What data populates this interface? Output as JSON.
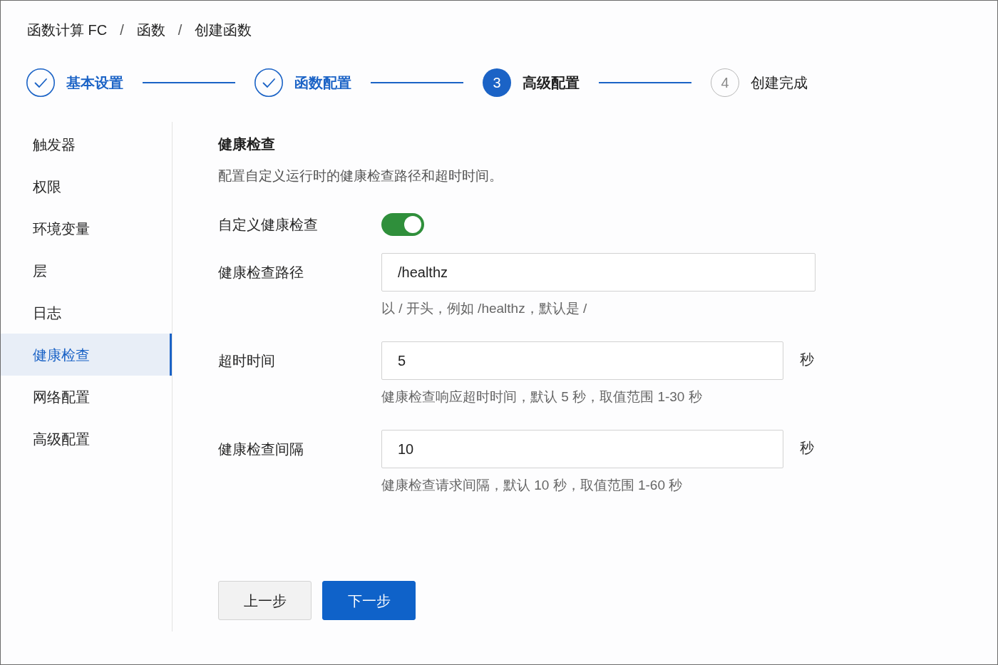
{
  "breadcrumb": [
    {
      "label": "函数计算 FC"
    },
    {
      "separator": "/",
      "label": "函数"
    },
    {
      "separator": "/",
      "label": "创建函数"
    }
  ],
  "steps": [
    {
      "kind": "done",
      "label": "基本设置"
    },
    {
      "kind": "done",
      "label": "函数配置"
    },
    {
      "kind": "current",
      "number": "3",
      "label": "高级配置"
    },
    {
      "kind": "waiting",
      "number": "4",
      "label": "创建完成"
    }
  ],
  "sidebar": {
    "items": [
      {
        "label": "触发器",
        "selected": false
      },
      {
        "label": "权限",
        "selected": false
      },
      {
        "label": "环境变量",
        "selected": false
      },
      {
        "label": "层",
        "selected": false
      },
      {
        "label": "日志",
        "selected": false
      },
      {
        "label": "健康检查",
        "selected": true
      },
      {
        "label": "网络配置",
        "selected": false
      },
      {
        "label": "高级配置",
        "selected": false
      }
    ]
  },
  "section": {
    "title": "健康检查",
    "description": "配置自定义运行时的健康检查路径和超时时间。",
    "fields": [
      {
        "kind": "switch",
        "label": "自定义健康检查",
        "on": true
      },
      {
        "kind": "text",
        "label": "健康检查路径",
        "value": "/healthz",
        "help": "以 / 开头，例如 /healthz，默认是 /"
      },
      {
        "kind": "number",
        "label": "超时时间",
        "value": "5",
        "unit": "秒",
        "help": "健康检查响应超时时间，默认 5 秒，取值范围 1-30 秒"
      },
      {
        "kind": "number",
        "label": "健康检查间隔",
        "value": "10",
        "unit": "秒",
        "help": "健康检查请求间隔，默认 10 秒，取值范围 1-60 秒"
      }
    ]
  },
  "buttons": [
    {
      "kind": "secondary",
      "label": "上一步"
    },
    {
      "kind": "primary",
      "label": "下一步"
    }
  ]
}
